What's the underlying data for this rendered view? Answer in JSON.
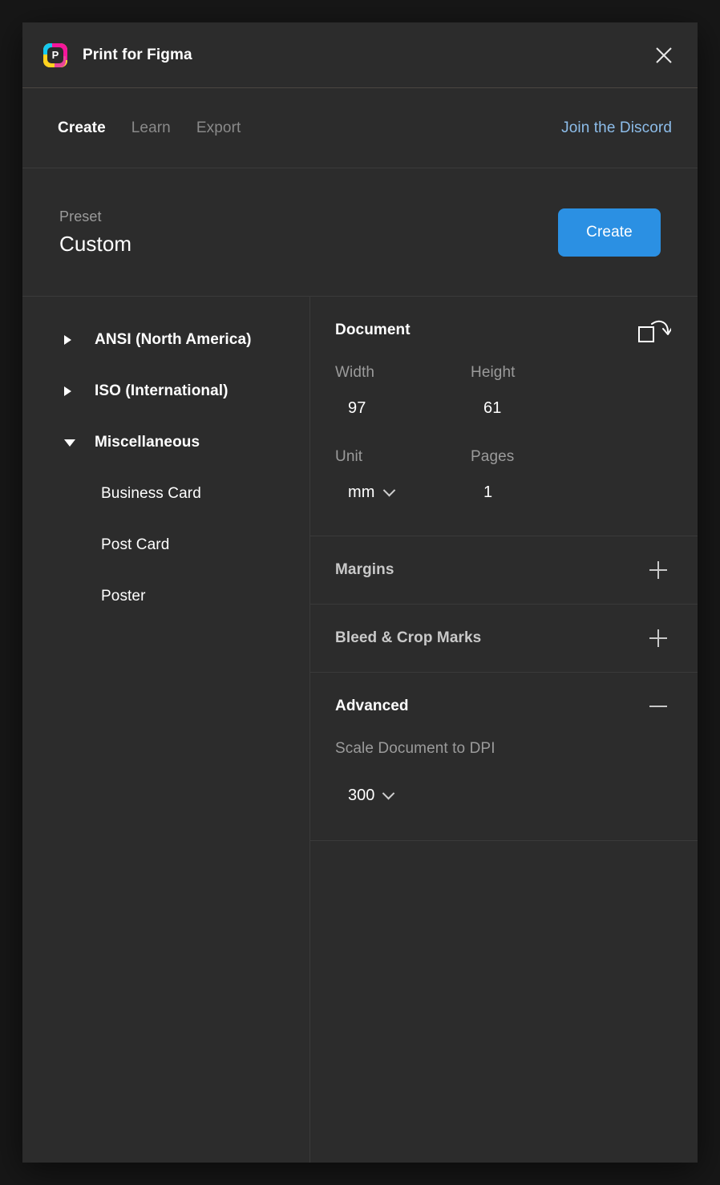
{
  "window": {
    "title": "Print for Figma",
    "logo_letter": "P",
    "logo_icon": "print-for-figma-logo",
    "close_icon": "close-icon"
  },
  "tabs": [
    {
      "label": "Create",
      "active": true
    },
    {
      "label": "Learn",
      "active": false
    },
    {
      "label": "Export",
      "active": false
    }
  ],
  "discord": {
    "label": "Join the Discord",
    "color": "#8dbdea"
  },
  "preset": {
    "label": "Preset",
    "value": "Custom",
    "create_button": "Create",
    "create_button_color": "#2b90e3"
  },
  "sidebar": {
    "groups": [
      {
        "label": "ANSI (North America)",
        "expanded": false,
        "items": []
      },
      {
        "label": "ISO (International)",
        "expanded": false,
        "items": []
      },
      {
        "label": "Miscellaneous",
        "expanded": true,
        "items": [
          "Business Card",
          "Post Card",
          "Poster"
        ]
      }
    ]
  },
  "settings": {
    "document": {
      "title": "Document",
      "rotate_icon": "rotate-orientation-icon",
      "width_label": "Width",
      "width_value": "97",
      "height_label": "Height",
      "height_value": "61",
      "unit_label": "Unit",
      "unit_value": "mm",
      "pages_label": "Pages",
      "pages_value": "1"
    },
    "margins": {
      "title": "Margins",
      "toggle": "plus-icon",
      "expanded": false
    },
    "bleed": {
      "title": "Bleed & Crop Marks",
      "toggle": "plus-icon",
      "expanded": false
    },
    "advanced": {
      "title": "Advanced",
      "toggle": "minus-icon",
      "expanded": true,
      "dpi_label": "Scale Document to DPI",
      "dpi_value": "300"
    }
  }
}
